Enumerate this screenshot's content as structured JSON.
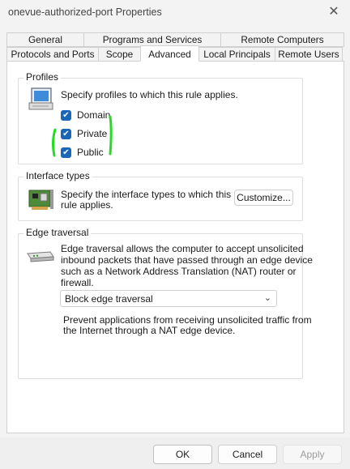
{
  "window": {
    "title": "onevue-authorized-port Properties",
    "close_glyph": "✕"
  },
  "tabs": {
    "row1": [
      {
        "label": "General"
      },
      {
        "label": "Programs and Services"
      },
      {
        "label": "Remote Computers"
      }
    ],
    "row2": [
      {
        "label": "Protocols and Ports"
      },
      {
        "label": "Scope"
      },
      {
        "label": "Advanced",
        "active": true
      },
      {
        "label": "Local Principals"
      },
      {
        "label": "Remote Users"
      }
    ]
  },
  "profiles": {
    "title": "Profiles",
    "description": "Specify profiles to which this rule applies.",
    "items": [
      {
        "label": "Domain",
        "checked": true
      },
      {
        "label": "Private",
        "checked": true
      },
      {
        "label": "Public",
        "checked": true
      }
    ],
    "annotation_color": "#22dd22"
  },
  "interface_types": {
    "title": "Interface types",
    "description_line1": "Specify the interface types to which this",
    "description_line2": "rule applies.",
    "customize_label": "Customize..."
  },
  "edge_traversal": {
    "title": "Edge traversal",
    "description_lines": [
      "Edge traversal allows the computer to accept unsolicited",
      "inbound packets that have passed through an edge device",
      "such as a Network Address Translation (NAT) router or",
      "firewall."
    ],
    "selected_option": "Block edge traversal",
    "option_help_lines": [
      "Prevent applications from receiving unsolicited traffic from",
      "the Internet through a NAT edge device."
    ]
  },
  "buttons": {
    "ok": "OK",
    "cancel": "Cancel",
    "apply": "Apply"
  },
  "colors": {
    "checkbox": "#1a66b8",
    "window_bg": "#f3f3f3",
    "panel_bg": "#ffffff"
  }
}
